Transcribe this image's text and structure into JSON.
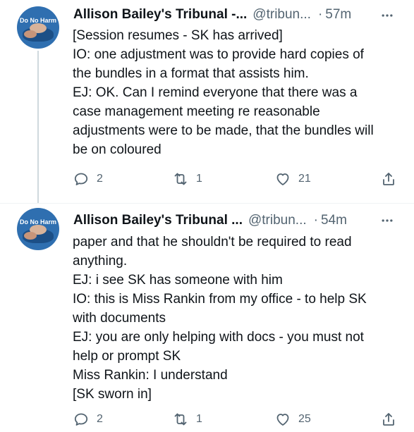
{
  "tweets": [
    {
      "avatar_text": "Do No Harm",
      "name": "Allison Bailey's Tribunal -...",
      "handle": "@tribun...",
      "separator": "·",
      "time": "57m",
      "lines": [
        "[Session resumes - SK has arrived]",
        "IO: one adjustment was to provide hard copies of",
        "the bundles in a format that assists him.",
        "EJ: OK. Can I remind everyone that there was a",
        "case management meeting re reasonable",
        "adjustments were to be made, that the bundles will",
        "be on coloured"
      ],
      "replies": "2",
      "retweets": "1",
      "likes": "21"
    },
    {
      "avatar_text": "Do No Harm",
      "name": "Allison Bailey's Tribunal ...",
      "handle": "@tribun...",
      "separator": "·",
      "time": "54m",
      "lines": [
        "paper and that he shouldn't be required to read",
        "anything.",
        "EJ: i see SK has someone with him",
        "IO: this is Miss Rankin from my office - to help SK",
        "with documents",
        "EJ: you are only helping with docs - you must not",
        "help or prompt SK",
        "Miss Rankin: I understand",
        "[SK sworn in]"
      ],
      "replies": "2",
      "retweets": "1",
      "likes": "25"
    }
  ],
  "icons": {
    "reply": "reply-icon",
    "retweet": "retweet-icon",
    "like": "heart-icon",
    "share": "share-icon",
    "more": "more-icon"
  },
  "colors": {
    "text": "#0f1419",
    "secondary": "#536471",
    "thread_line": "#cfd9de",
    "avatar_bg": "#2f6fb0"
  }
}
